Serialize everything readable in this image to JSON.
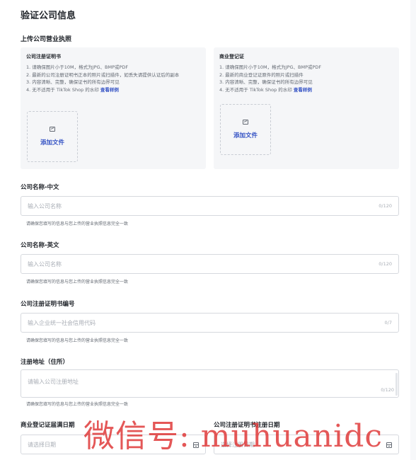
{
  "title": "验证公司信息",
  "upload_section_label": "上传公司营业执照",
  "panels": [
    {
      "title": "公司注册证明书",
      "requirements": [
        "1. 请确保图片小于10M，格式为JPG、BMP或PDF",
        "2. 最新的公司注册证明书正本的照片或扫描件，如丢失请提供认证后的副本",
        "3. 内容清晰、完整，确保证书的所有边界可见",
        "4. 无不适用于 TikTok Shop 的水印"
      ],
      "sample_link": "查看样例",
      "add_file": "添加文件"
    },
    {
      "title": "商业登记证",
      "requirements": [
        "1. 请确保图片小于10M，格式为JPG、BMP或PDF",
        "2. 最新的商业登记证原件的照片或扫描件",
        "3. 内容清晰、完整，确保证书的所有边界可见",
        "4. 无不适用于 TikTok Shop 的水印"
      ],
      "sample_link": "查看样例",
      "add_file": "添加文件"
    }
  ],
  "fields": {
    "name_cn": {
      "label": "公司名称-中文",
      "placeholder": "输入公司名称",
      "count": "0/120",
      "hint": "请确保您填写的信息与您上传的营业执照信息完全一致"
    },
    "name_en": {
      "label": "公司名称-英文",
      "placeholder": "输入公司名称",
      "count": "0/120",
      "hint": "请确保您填写的信息与您上传的营业执照信息完全一致"
    },
    "cert_no": {
      "label": "公司注册证明书编号",
      "placeholder": "输入企业统一社会信用代码",
      "count": "0/7",
      "hint": "请确保您填写的信息与您上传的营业执照信息完全一致"
    },
    "address": {
      "label": "注册地址（住所）",
      "placeholder": "请输入公司注册地址",
      "count": "0/120",
      "hint": "请确保您填写的信息与您上传的营业执照信息完全一致"
    }
  },
  "dates": {
    "expiry": {
      "label": "商业登记证届满日期",
      "placeholder": "请选择日期"
    },
    "registration": {
      "label": "公司注册证明书注册日期",
      "placeholder": "选择注册日期"
    }
  },
  "watermark": "微信号: muhuanidc",
  "colors": {
    "accent": "#3452c4",
    "watermark": "#dc2828"
  },
  "icons": {
    "upload": "image-icon",
    "date": "calendar-icon"
  }
}
